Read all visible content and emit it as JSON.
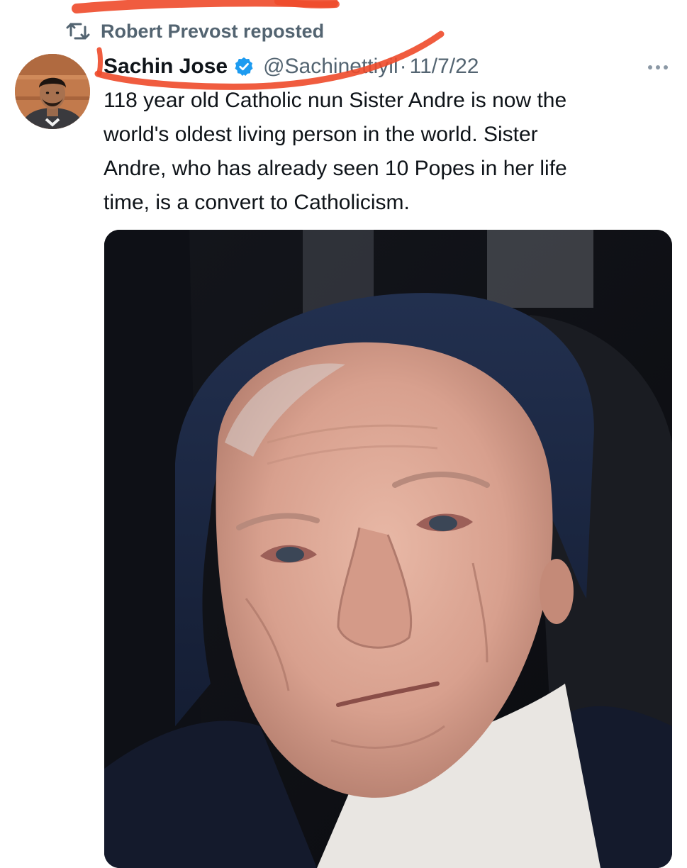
{
  "repost": {
    "icon": "repost-icon",
    "text": "Robert Prevost reposted"
  },
  "tweet": {
    "avatar_icon": "user-avatar",
    "display_name": "Sachin Jose",
    "verified_icon": "verified-badge-icon",
    "handle": "@Sachinettiyil",
    "separator": "·",
    "date": "11/7/22",
    "more_icon": "more-options-icon",
    "text": "118 year old Catholic nun Sister Andre is now the\nworld's oldest living person in the world. Sister\nAndre, who has already seen 10 Popes in her life\ntime, is a convert to Catholicism.",
    "media_description_icon": "photo-elderly-nun"
  },
  "colors": {
    "text_primary": "#0f1419",
    "text_secondary": "#536471",
    "verified_blue": "#1d9bf0",
    "highlighter_red": "#ee4a2a"
  }
}
